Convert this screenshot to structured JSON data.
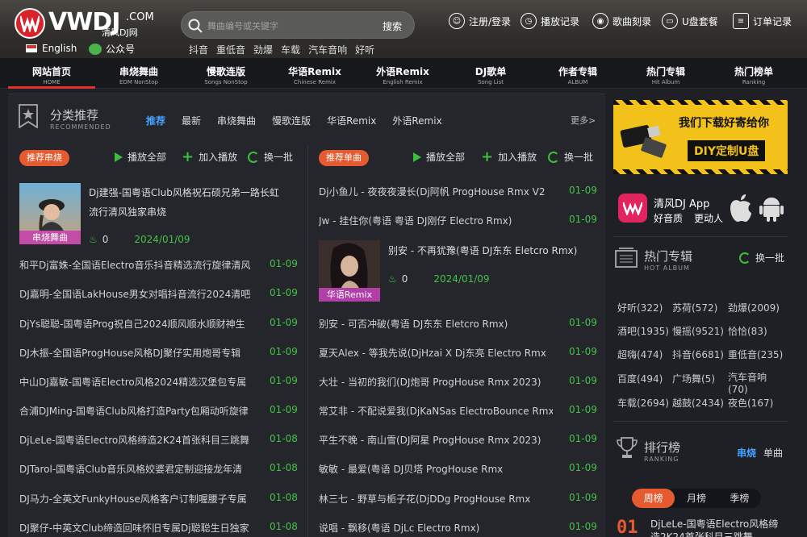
{
  "header": {
    "logo_text": "VWDJ",
    "logo_com": ".COM",
    "logo_cn": "清风DJ网",
    "lang": "English",
    "wechat": "公众号",
    "search_placeholder": "舞曲编号或关键字",
    "search_button": "搜索",
    "tags": [
      "抖音",
      "重低音",
      "劲爆",
      "车载",
      "汽车音响",
      "好听"
    ],
    "topnav": [
      {
        "label": "注册/登录",
        "icon": "user-icon"
      },
      {
        "label": "播放记录",
        "icon": "clock-icon"
      },
      {
        "label": "歌曲刻录",
        "icon": "disc-icon"
      },
      {
        "label": "U盘套餐",
        "icon": "usb-icon"
      },
      {
        "label": "订单记录",
        "icon": "order-icon"
      }
    ]
  },
  "mainnav": [
    {
      "cn": "网站首页",
      "en": "HOME"
    },
    {
      "cn": "串烧舞曲",
      "en": "EDM NonStop"
    },
    {
      "cn": "慢歌连版",
      "en": "Songs NonStop"
    },
    {
      "cn": "华语Remix",
      "en": "Chinese Remix"
    },
    {
      "cn": "外语Remix",
      "en": "English Remix"
    },
    {
      "cn": "DJ歌单",
      "en": "Song List"
    },
    {
      "cn": "作者专辑",
      "en": "ALBUM"
    },
    {
      "cn": "热门专辑",
      "en": "Hit Album"
    },
    {
      "cn": "热门榜单",
      "en": "Ranking"
    }
  ],
  "recommend": {
    "title": "分类推荐",
    "sub": "RECOMMENDED",
    "tabs": [
      "推荐",
      "最新",
      "串烧舞曲",
      "慢歌连版",
      "华语Remix",
      "外语Remix"
    ],
    "more": "更多>"
  },
  "actions": {
    "play_all": "播放全部",
    "add": "加入播放",
    "refresh": "换一批"
  },
  "left_col": {
    "badge": "推荐串烧",
    "featured": {
      "title": "Dj建强-国粤语Club风格祝石硕兄弟一路长虹流行清风独家串烧",
      "caption": "串烧舞曲",
      "likes": "0",
      "date": "2024/01/09"
    },
    "rows": [
      {
        "title": "和平Dj富姝-全国语Electro音乐抖音精选流行旋律清风",
        "date": "01-09"
      },
      {
        "title": "DJ嘉明-全国语LakHouse男女对唱抖音流行2024清吧",
        "date": "01-09"
      },
      {
        "title": "DjYs聪聪-国粤语Prog祝自己2024顺风顺水顺财神生",
        "date": "01-09"
      },
      {
        "title": "DJ木振-全国语ProgHouse风格DJ聚仔实用炮哥专辑",
        "date": "01-09"
      },
      {
        "title": "中山DJ嘉敏-国粤语Electro风格2024精选汉堡包专属",
        "date": "01-09"
      },
      {
        "title": "合浦DJMing-国粤语Club风格打造Party包厢动听旋律",
        "date": "01-09"
      },
      {
        "title": "DjLeLe-国粤语Electro风格缔造2K24首张科目三跳舞",
        "date": "01-08"
      },
      {
        "title": "DJTarol-国粤语Club音乐风格姣婆君定制迎接龙年清",
        "date": "01-08"
      },
      {
        "title": "DJ马力-全英文FunkyHouse风格客户订制喔腰子专属",
        "date": "01-08"
      },
      {
        "title": "DJ聚仔-中英文Club缔造回味怀旧专属Dj聪聪生日独家",
        "date": "01-08"
      }
    ]
  },
  "right_col": {
    "badge": "推荐单曲",
    "top_rows": [
      {
        "title": "Dj小鱼儿 - 夜夜夜漫长(Dj阿帆 ProgHouse Rmx V2",
        "date": "01-09"
      },
      {
        "title": "Jw - 挂住你(粤语 粤语 DJ刚仔 Electro Rmx)",
        "date": "01-09"
      }
    ],
    "featured": {
      "title": "别安 - 不再犹豫(粤语 DJ东东 Eletcro Rmx)",
      "caption": "华语Remix",
      "likes": "0",
      "date": "2024/01/09"
    },
    "rows": [
      {
        "title": "别安 - 可否冲破(粤语 DJ东东 Eletcro Rmx)",
        "date": "01-09"
      },
      {
        "title": "夏天Alex - 等我先说(DjHzai X Dj东亮 Electro Rmx",
        "date": "01-09"
      },
      {
        "title": "大壮 - 当初的我们(DJ炮哥 ProgHouse Rmx 2023)",
        "date": "01-09"
      },
      {
        "title": "常艾非 - 不配说爱我(DjKaNSas ElectroBounce Rmx",
        "date": "01-09"
      },
      {
        "title": "平生不晚 - 南山雪(DJ阿星 ProgHouse Rmx 2023)",
        "date": "01-09"
      },
      {
        "title": "敏敏 - 最爱(粤语 DJ贝塔 ProgHouse Rmx",
        "date": "01-09"
      },
      {
        "title": "林三七 - 野草与栀子花(DjDDg ProgHouse Rmx",
        "date": "01-09"
      },
      {
        "title": "说唱 - 飘移(粤语 DjLc Electro Rmx)",
        "date": "01-09"
      }
    ]
  },
  "ad": {
    "line1": "我们下载好寄给你",
    "line2": "DIY定制U盘"
  },
  "app": {
    "name": "清风DJ App",
    "slogan1": "好音质",
    "slogan2": "更动人"
  },
  "hot_album": {
    "title": "热门专辑",
    "sub": "HOT ALBUM",
    "refresh": "换一批",
    "genres": [
      [
        "好听(322)",
        "苏荷(572)",
        "劲爆(2009)"
      ],
      [
        "酒吧(1935)",
        "慢摇(9521)",
        "恰恰(83)"
      ],
      [
        "超嗨(474)",
        "抖音(6681)",
        "重低音(235)"
      ],
      [
        "百度(494)",
        "广场舞(5)",
        "汽车音响(70)"
      ],
      [
        "车载(2694)",
        "越鼓(2434)",
        "夜色(167)"
      ]
    ]
  },
  "ranking": {
    "title": "排行榜",
    "sub": "RANKING",
    "type_tabs": [
      "串烧",
      "单曲"
    ],
    "period_tabs": [
      "周榜",
      "月榜",
      "季榜"
    ],
    "first": {
      "rank": "01",
      "title": "DjLeLe-国粤语Electro风格缔造2K24首张科目三跳舞"
    }
  },
  "colors": {
    "accent": "#e55b2f",
    "green": "#45c247",
    "blue": "#43a3ff",
    "nav_red": "#e0342b"
  }
}
